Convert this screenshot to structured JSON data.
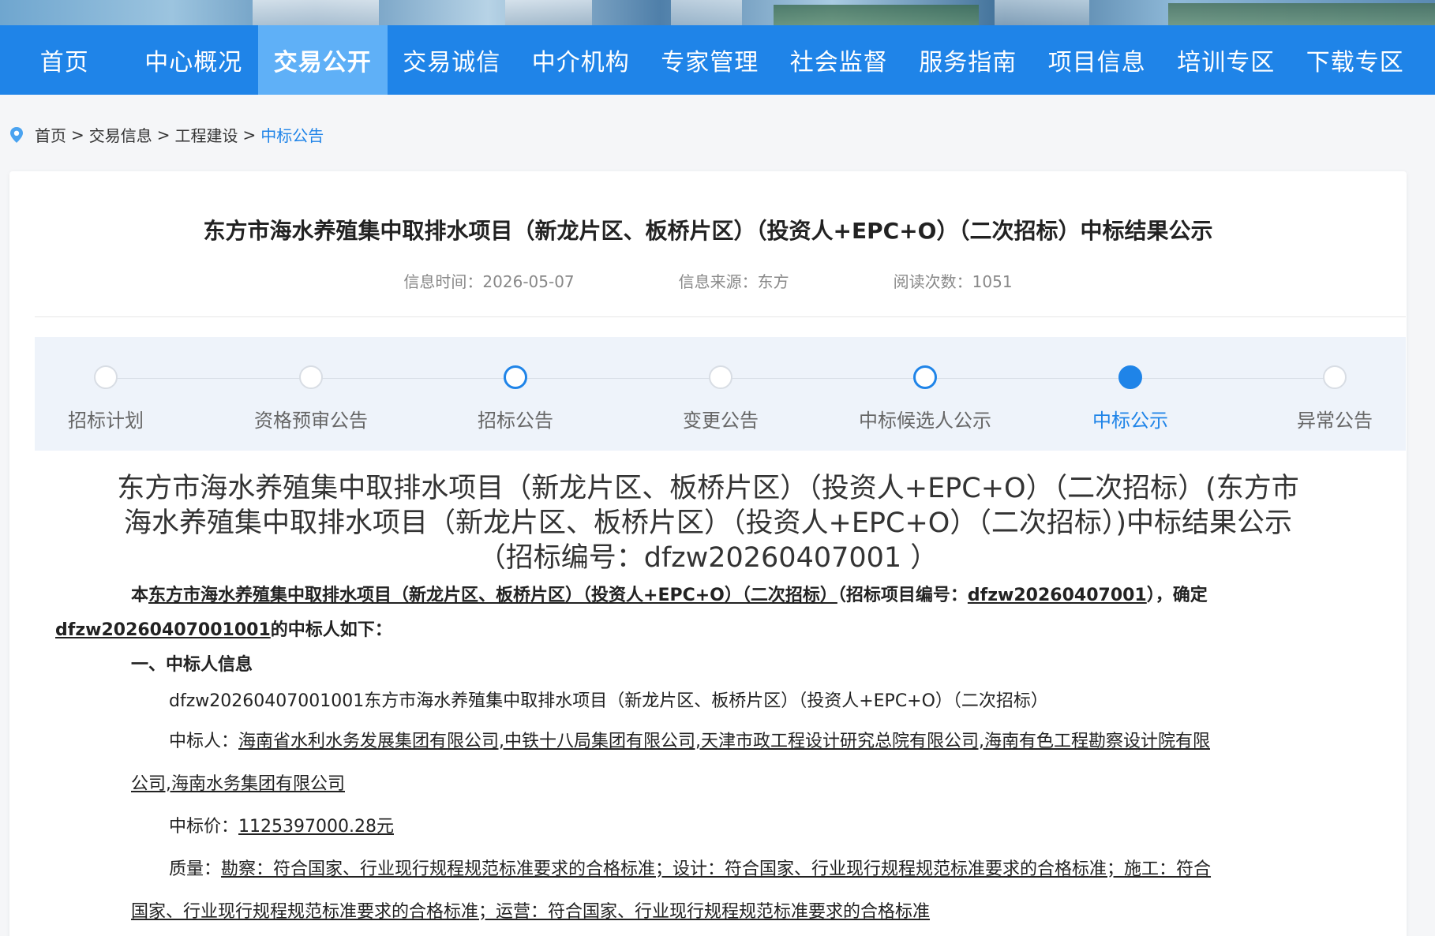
{
  "nav": {
    "items": [
      "首页",
      "中心概况",
      "交易公开",
      "交易诚信",
      "中介机构",
      "专家管理",
      "社会监督",
      "服务指南",
      "项目信息",
      "培训专区",
      "下载专区"
    ],
    "active_index": 2
  },
  "breadcrumb": {
    "items": [
      "首页",
      "交易信息",
      "工程建设"
    ],
    "current": "中标公告",
    "sep": ">"
  },
  "article": {
    "title": "东方市海水养殖集中取排水项目（新龙片区、板桥片区）（投资人+EPC+O）（二次招标）中标结果公示",
    "meta": {
      "time": "信息时间：2026-05-07",
      "source": "信息来源：东方",
      "reads": "阅读次数：1051"
    }
  },
  "steps": {
    "items": [
      {
        "label": "招标计划",
        "state": "normal"
      },
      {
        "label": "资格预审公告",
        "state": "normal"
      },
      {
        "label": "招标公告",
        "state": "highlight"
      },
      {
        "label": "变更公告",
        "state": "normal"
      },
      {
        "label": "中标候选人公示",
        "state": "highlight"
      },
      {
        "label": "中标公示",
        "state": "current"
      },
      {
        "label": "异常公告",
        "state": "normal"
      }
    ]
  },
  "body": {
    "big_title_line1": "东方市海水养殖集中取排水项目（新龙片区、板桥片区）（投资人+EPC+O）（二次招标）(东方市",
    "big_title_line2": "海水养殖集中取排水项目（新龙片区、板桥片区）（投资人+EPC+O）（二次招标）)中标结果公示",
    "big_title_line3": "（招标编号：dfzw20260407001 ）",
    "lead_prefix": "本",
    "lead_project": "东方市海水养殖集中取排水项目（新龙片区、板桥片区）（投资人+EPC+O）（二次招标）",
    "lead_mid": "（招标项目编号：",
    "lead_code": "dfzw20260407001",
    "lead_mid2": "），确定",
    "lead_section": "dfzw20260407001001",
    "lead_suffix": "的中标人如下：",
    "section1": "一、中标人信息",
    "section_name": "dfzw20260407001001东方市海水养殖集中取排水项目（新龙片区、板桥片区）（投资人+EPC+O）（二次招标）",
    "winner_label": "中标人：",
    "winner_value_1": "海南省水利水务发展集团有限公司,中铁十八局集团有限公司,天津市政工程设计研究总院有限公司,海南有色工程勘察设计院有限",
    "winner_value_2": "公司,海南水务集团有限公司",
    "price_label": "中标价：",
    "price_value": "1125397000.28元",
    "quality_label": "质量：",
    "quality_value_1": "勘察：符合国家、行业现行规程规范标准要求的合格标准；设计：符合国家、行业现行规程规范标准要求的合格标准；施工：符合",
    "quality_value_2": "国家、行业现行规程规范标准要求的合格标准；运营：符合国家、行业现行规程规范标准要求的合格标准"
  }
}
